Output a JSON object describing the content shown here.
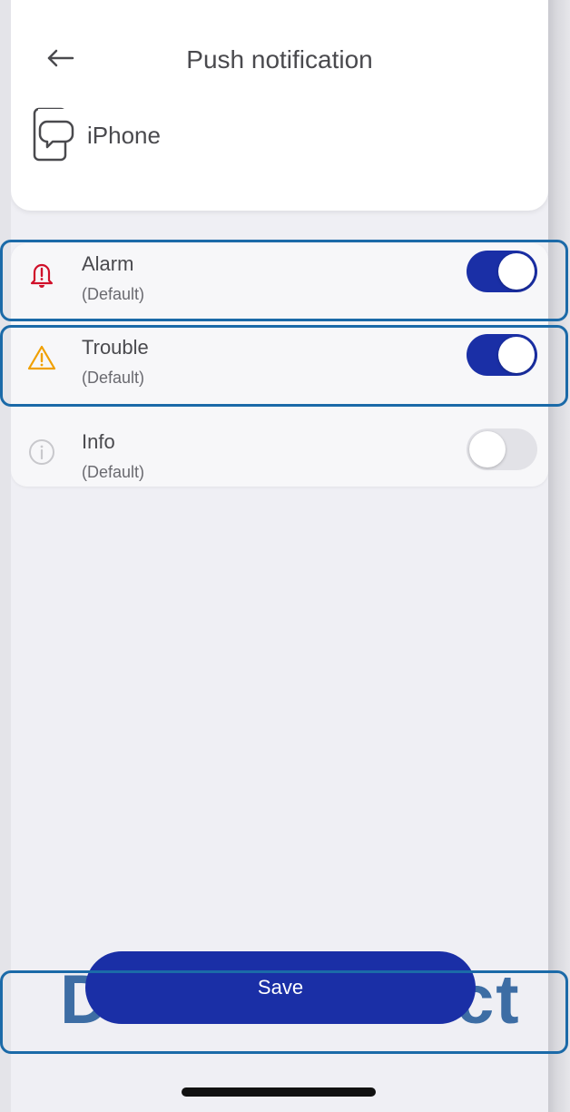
{
  "header": {
    "title": "Push notification",
    "device_name": "iPhone"
  },
  "notifications": [
    {
      "title": "Alarm",
      "subtitle": "(Default)",
      "enabled": true,
      "icon": "alarm-bell-icon",
      "color": "#d0102a"
    },
    {
      "title": "Trouble",
      "subtitle": "(Default)",
      "enabled": true,
      "icon": "warning-triangle-icon",
      "color": "#f0a000"
    },
    {
      "title": "Info",
      "subtitle": "(Default)",
      "enabled": false,
      "icon": "info-circle-icon",
      "color": "#c8c8cc"
    }
  ],
  "footer": {
    "brand_text": "DSC Connect",
    "save_label": "Save"
  },
  "colors": {
    "accent": "#1a2fa6",
    "highlight": "#1b6aa8"
  }
}
